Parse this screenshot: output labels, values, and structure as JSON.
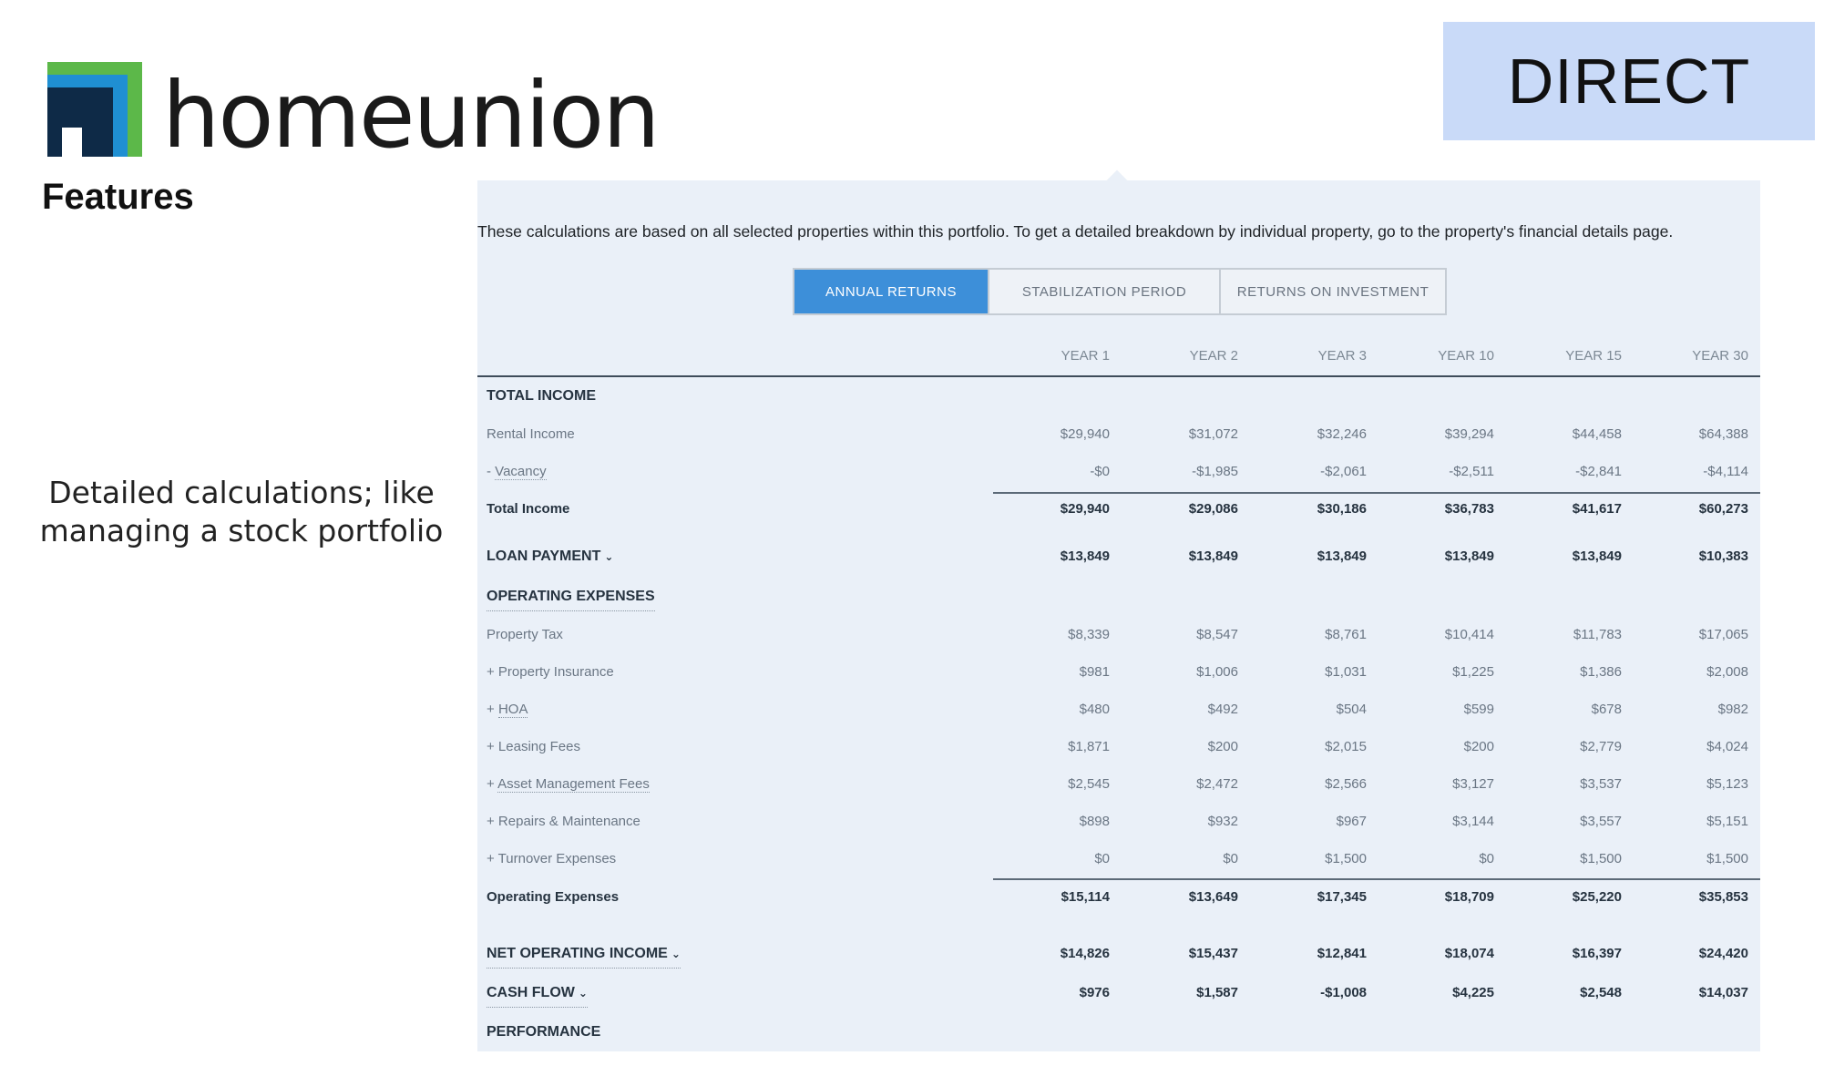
{
  "brand": {
    "name": "homeunion",
    "badge": "DIRECT"
  },
  "slide": {
    "heading": "Features",
    "caption_line1": "Detailed calculations; like",
    "caption_line2": "managing a stock portfolio"
  },
  "panel": {
    "intro": "These calculations are based on all selected properties within this portfolio. To get a detailed breakdown by individual property, go to the property's financial details page.",
    "tabs": [
      {
        "label": "ANNUAL RETURNS",
        "active": true
      },
      {
        "label": "STABILIZATION PERIOD",
        "active": false
      },
      {
        "label": "RETURNS ON INVESTMENT",
        "active": false
      }
    ],
    "columns": [
      "YEAR 1",
      "YEAR 2",
      "YEAR 3",
      "YEAR 10",
      "YEAR 15",
      "YEAR 30"
    ],
    "rows": {
      "total_income_header": "TOTAL INCOME",
      "rental_income": {
        "label": "Rental Income",
        "values": [
          "$29,940",
          "$31,072",
          "$32,246",
          "$39,294",
          "$44,458",
          "$64,388"
        ]
      },
      "vacancy": {
        "prefix": "- ",
        "label": "Vacancy",
        "values": [
          "-$0",
          "-$1,985",
          "-$2,061",
          "-$2,511",
          "-$2,841",
          "-$4,114"
        ]
      },
      "total_income": {
        "label": "Total Income",
        "values": [
          "$29,940",
          "$29,086",
          "$30,186",
          "$36,783",
          "$41,617",
          "$60,273"
        ]
      },
      "loan_payment": {
        "label": "LOAN PAYMENT",
        "values": [
          "$13,849",
          "$13,849",
          "$13,849",
          "$13,849",
          "$13,849",
          "$10,383"
        ]
      },
      "operating_expenses_header": "OPERATING EXPENSES",
      "property_tax": {
        "label": "Property Tax",
        "values": [
          "$8,339",
          "$8,547",
          "$8,761",
          "$10,414",
          "$11,783",
          "$17,065"
        ]
      },
      "property_insurance": {
        "label": "+ Property Insurance",
        "values": [
          "$981",
          "$1,006",
          "$1,031",
          "$1,225",
          "$1,386",
          "$2,008"
        ]
      },
      "hoa": {
        "prefix": "+ ",
        "label": "HOA",
        "values": [
          "$480",
          "$492",
          "$504",
          "$599",
          "$678",
          "$982"
        ]
      },
      "leasing_fees": {
        "label": "+ Leasing Fees",
        "values": [
          "$1,871",
          "$200",
          "$2,015",
          "$200",
          "$2,779",
          "$4,024"
        ]
      },
      "asset_management_fees": {
        "prefix": "+ ",
        "label": "Asset Management Fees",
        "values": [
          "$2,545",
          "$2,472",
          "$2,566",
          "$3,127",
          "$3,537",
          "$5,123"
        ]
      },
      "repairs_maintenance": {
        "label": "+ Repairs & Maintenance",
        "values": [
          "$898",
          "$932",
          "$967",
          "$3,144",
          "$3,557",
          "$5,151"
        ]
      },
      "turnover_expenses": {
        "label": "+ Turnover Expenses",
        "values": [
          "$0",
          "$0",
          "$1,500",
          "$0",
          "$1,500",
          "$1,500"
        ]
      },
      "operating_expenses": {
        "label": "Operating Expenses",
        "values": [
          "$15,114",
          "$13,649",
          "$17,345",
          "$18,709",
          "$25,220",
          "$35,853"
        ]
      },
      "net_operating_income": {
        "label": "NET OPERATING INCOME",
        "values": [
          "$14,826",
          "$15,437",
          "$12,841",
          "$18,074",
          "$16,397",
          "$24,420"
        ]
      },
      "cash_flow": {
        "label": "CASH FLOW",
        "values": [
          "$976",
          "$1,587",
          "-$1,008",
          "$4,225",
          "$2,548",
          "$14,037"
        ]
      },
      "performance_header": "PERFORMANCE"
    }
  },
  "icons": {
    "chevron": "chevron-down-icon"
  },
  "colors": {
    "tab_active": "#3d8fd9",
    "panel_bg": "#eaf0f8",
    "badge_bg": "#c9daf8",
    "logo_green": "#5cb849",
    "logo_blue": "#1f8fd2",
    "logo_navy": "#0e2a47"
  }
}
